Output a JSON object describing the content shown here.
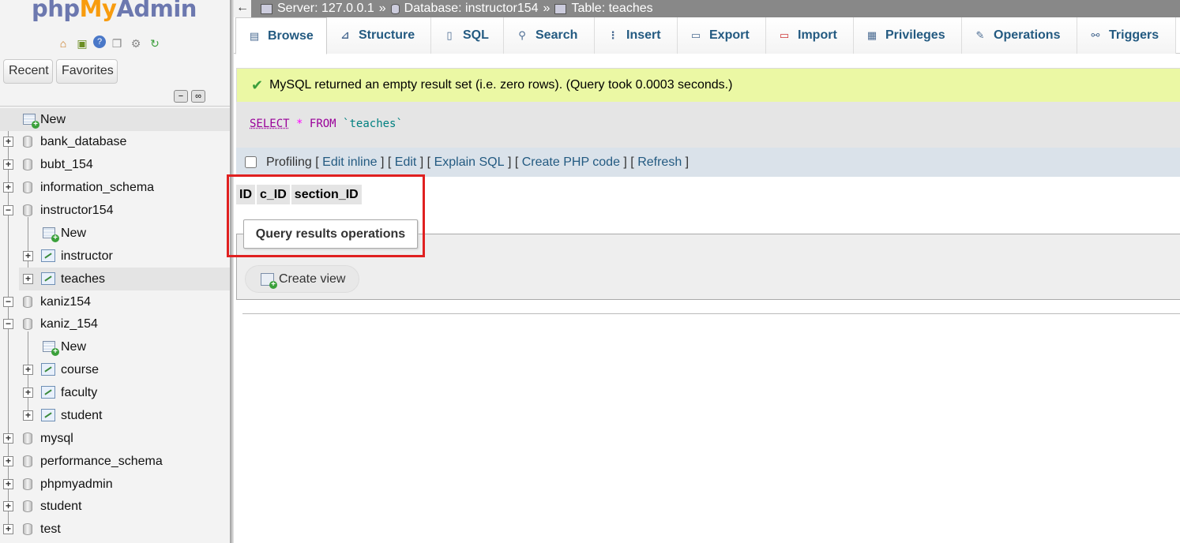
{
  "logo": {
    "php": "php",
    "my": "My",
    "admin": "Admin"
  },
  "sidebar": {
    "tabs": [
      {
        "label": "Recent"
      },
      {
        "label": "Favorites"
      }
    ],
    "tree": [
      {
        "label": "New"
      },
      {
        "label": "bank_database"
      },
      {
        "label": "bubt_154"
      },
      {
        "label": "information_schema"
      },
      {
        "label": "instructor154"
      },
      {
        "label": "New"
      },
      {
        "label": "instructor"
      },
      {
        "label": "teaches"
      },
      {
        "label": "kaniz154"
      },
      {
        "label": "kaniz_154"
      },
      {
        "label": "New"
      },
      {
        "label": "course"
      },
      {
        "label": "faculty"
      },
      {
        "label": "student"
      },
      {
        "label": "mysql"
      },
      {
        "label": "performance_schema"
      },
      {
        "label": "phpmyadmin"
      },
      {
        "label": "student"
      },
      {
        "label": "test"
      }
    ]
  },
  "breadcrumb": {
    "server": "Server: 127.0.0.1",
    "database": "Database: instructor154",
    "table": "Table: teaches",
    "separator": "»"
  },
  "tabs": [
    {
      "label": "Browse",
      "icon": "browse-icon"
    },
    {
      "label": "Structure",
      "icon": "structure-icon"
    },
    {
      "label": "SQL",
      "icon": "sql-icon"
    },
    {
      "label": "Search",
      "icon": "search-icon"
    },
    {
      "label": "Insert",
      "icon": "insert-icon"
    },
    {
      "label": "Export",
      "icon": "export-icon"
    },
    {
      "label": "Import",
      "icon": "import-icon"
    },
    {
      "label": "Privileges",
      "icon": "privileges-icon"
    },
    {
      "label": "Operations",
      "icon": "operations-icon"
    },
    {
      "label": "Triggers",
      "icon": "triggers-icon"
    }
  ],
  "message": "MySQL returned an empty result set (i.e. zero rows). (Query took 0.0003 seconds.)",
  "sql": {
    "select": "SELECT",
    "star": "*",
    "from": "FROM",
    "table": "`teaches`"
  },
  "profiling": {
    "label": "Profiling",
    "links": [
      "Edit inline",
      "Edit",
      "Explain SQL",
      "Create PHP code",
      "Refresh"
    ]
  },
  "columns": [
    "ID",
    "c_ID",
    "section_ID"
  ],
  "query_results_operations": "Query results operations",
  "create_view": "Create view",
  "colors": {
    "accent": "#235a81",
    "success_bg": "#ebf8a4",
    "highlight": "#e02020"
  }
}
